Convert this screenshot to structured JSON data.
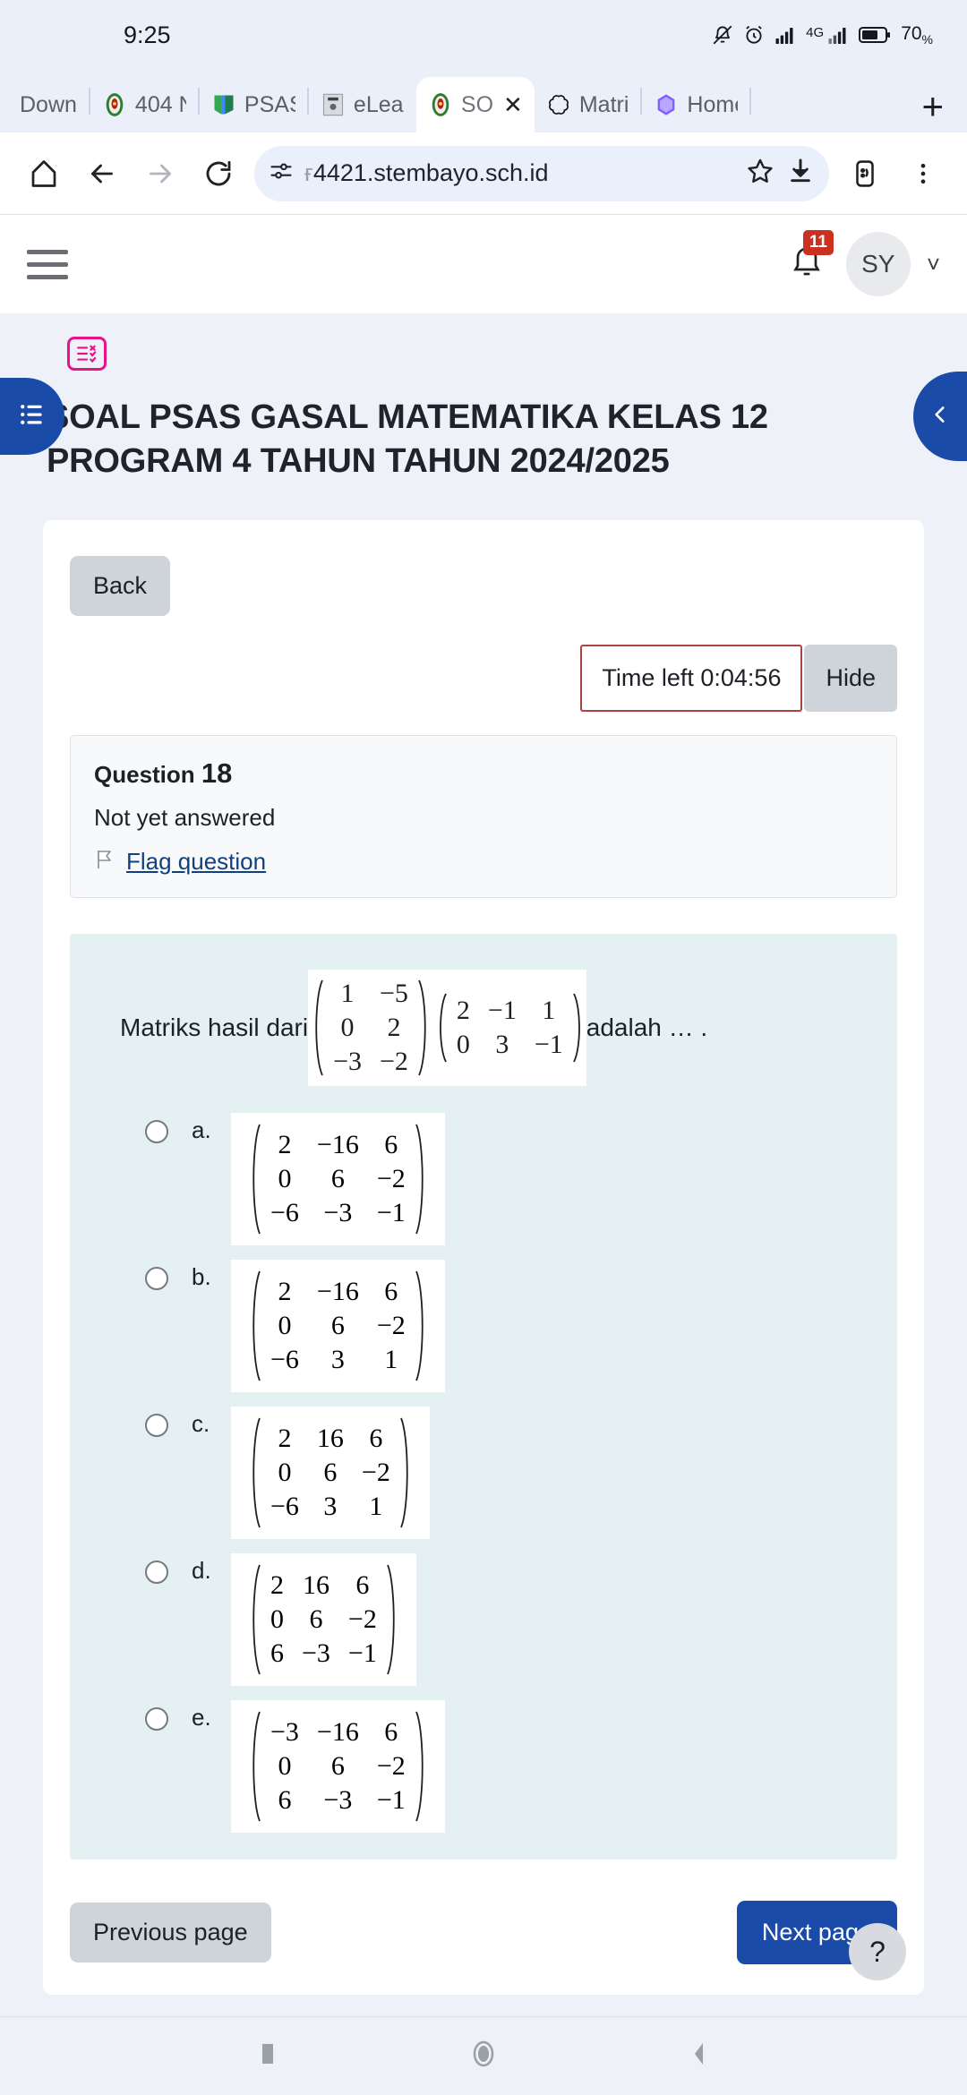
{
  "status_bar": {
    "time": "9:25",
    "battery_percent": "70",
    "battery_unit": "%",
    "network": "4G",
    "icons": [
      "mute-icon",
      "alarm-icon",
      "signal-bars-icon",
      "signal-bars-4g-icon",
      "battery-icon"
    ]
  },
  "browser": {
    "tabs": [
      {
        "label": "Down",
        "favicon": "none",
        "active": false
      },
      {
        "label": "404 N",
        "favicon": "school-crest",
        "active": false
      },
      {
        "label": "PSAS",
        "favicon": "book",
        "active": false
      },
      {
        "label": "eLear",
        "favicon": "elearning",
        "active": false
      },
      {
        "label": "SO",
        "favicon": "school-crest",
        "active": true
      },
      {
        "label": "Matri",
        "favicon": "chatgpt",
        "active": false
      },
      {
        "label": "Home",
        "favicon": "copilot",
        "active": false
      }
    ],
    "new_tab_label": "+",
    "close_tab_label": "✕",
    "url": "4421.stembayo.sch.id",
    "url_prefix": "ғ",
    "toolbar_icons": [
      "home-icon",
      "back-icon",
      "forward-icon",
      "reload-icon",
      "site-settings-icon",
      "bookmark-star-icon",
      "download-icon",
      "reader-mode-icon",
      "overflow-menu-icon"
    ]
  },
  "moodle_nav": {
    "menu_label": "menu",
    "notification_count": "11",
    "avatar_initials": "SY",
    "chevron": "˅"
  },
  "drawers": {
    "left_tab_icon": "list-icon",
    "right_tab_icon": "chevron-left-icon"
  },
  "page": {
    "activity_icon": "quiz-icon",
    "title": "SOAL PSAS GASAL MATEMATIKA KELAS 12 PROGRAM 4 TAHUN TAHUN 2024/2025"
  },
  "quiz": {
    "back_label": "Back",
    "timer_label": "Time left 0:04:56",
    "hide_label": "Hide",
    "question_label": "Question",
    "question_number": "18",
    "state": "Not yet answered",
    "flag_label": "Flag question",
    "previous_page_label": "Previous page",
    "next_page_label": "Next page",
    "help_label": "?"
  },
  "question": {
    "prompt_before": "Matriks hasil dari",
    "prompt_after": "adalah … .",
    "matrix_a": {
      "rows": 3,
      "cols": 2,
      "values": [
        [
          "1",
          "−5"
        ],
        [
          "0",
          "2"
        ],
        [
          "−3",
          "−2"
        ]
      ]
    },
    "matrix_b": {
      "rows": 2,
      "cols": 3,
      "values": [
        [
          "2",
          "−1",
          "1"
        ],
        [
          "0",
          "3",
          "−1"
        ]
      ]
    },
    "options": [
      {
        "letter": "a.",
        "matrix": {
          "rows": 3,
          "cols": 3,
          "values": [
            [
              "2",
              "−16",
              "6"
            ],
            [
              "0",
              "6",
              "−2"
            ],
            [
              "−6",
              "−3",
              "−1"
            ]
          ]
        }
      },
      {
        "letter": "b.",
        "matrix": {
          "rows": 3,
          "cols": 3,
          "values": [
            [
              "2",
              "−16",
              "6"
            ],
            [
              "0",
              "6",
              "−2"
            ],
            [
              "−6",
              "3",
              "1"
            ]
          ]
        }
      },
      {
        "letter": "c.",
        "matrix": {
          "rows": 3,
          "cols": 3,
          "values": [
            [
              "2",
              "16",
              "6"
            ],
            [
              "0",
              "6",
              "−2"
            ],
            [
              "−6",
              "3",
              "1"
            ]
          ]
        }
      },
      {
        "letter": "d.",
        "matrix": {
          "rows": 3,
          "cols": 3,
          "values": [
            [
              "2",
              "16",
              "6"
            ],
            [
              "0",
              "6",
              "−2"
            ],
            [
              "6",
              "−3",
              "−1"
            ]
          ]
        }
      },
      {
        "letter": "e.",
        "matrix": {
          "rows": 3,
          "cols": 3,
          "values": [
            [
              "−3",
              "−16",
              "6"
            ],
            [
              "0",
              "6",
              "−2"
            ],
            [
              "6",
              "−3",
              "−1"
            ]
          ]
        }
      }
    ]
  },
  "android_nav": {
    "recents_icon": "square-icon",
    "home_icon": "circle-icon",
    "back_icon": "triangle-back-icon"
  },
  "colors": {
    "brand_blue": "#1b4ba8",
    "accent_pink": "#e8128c",
    "timer_border": "#a94442",
    "badge_red": "#ca3120",
    "question_bg": "#e4f0f2"
  }
}
